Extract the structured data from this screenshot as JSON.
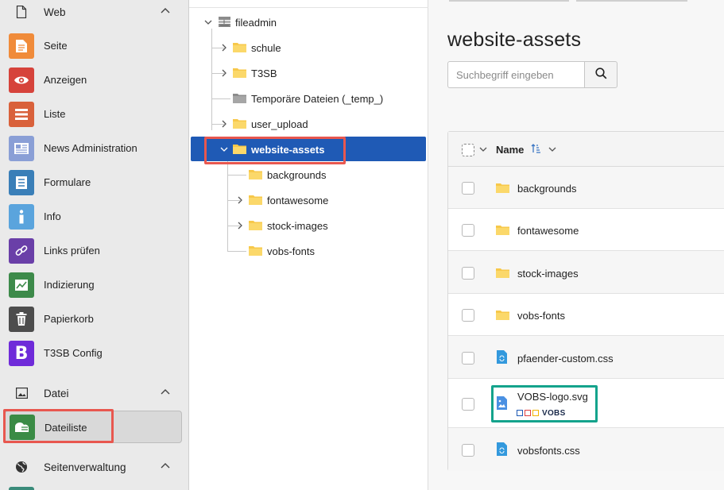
{
  "sidebar": {
    "groups": [
      {
        "label": "Web",
        "icon": "page-icon"
      },
      {
        "label": "Datei",
        "icon": "image-icon"
      },
      {
        "label": "Seitenverwaltung",
        "icon": "globe-icon"
      }
    ],
    "modules": [
      {
        "label": "Seite",
        "color": "#f08b3a"
      },
      {
        "label": "Anzeigen",
        "color": "#d6433b"
      },
      {
        "label": "Liste",
        "color": "#d9613b"
      },
      {
        "label": "News Administration",
        "color": "#8a9fd6"
      },
      {
        "label": "Formulare",
        "color": "#3a7fb8"
      },
      {
        "label": "Info",
        "color": "#5aa4dd"
      },
      {
        "label": "Links prüfen",
        "color": "#6a3fa8"
      },
      {
        "label": "Indizierung",
        "color": "#3d8a4a"
      },
      {
        "label": "Papierkorb",
        "color": "#4d4d4d"
      },
      {
        "label": "T3SB Config",
        "color": "#6f2bd9",
        "glyph": "B"
      },
      {
        "label": "Dateiliste",
        "color": "#3a8b45"
      }
    ]
  },
  "tree": {
    "root": "fileadmin",
    "nodes": [
      {
        "label": "schule"
      },
      {
        "label": "T3SB"
      },
      {
        "label": "Temporäre Dateien (_temp_)"
      },
      {
        "label": "user_upload"
      },
      {
        "label": "website-assets"
      },
      {
        "label": "backgrounds"
      },
      {
        "label": "fontawesome"
      },
      {
        "label": "stock-images"
      },
      {
        "label": "vobs-fonts"
      }
    ]
  },
  "main": {
    "title": "website-assets",
    "search_placeholder": "Suchbegriff eingeben",
    "column_name": "Name",
    "rows": [
      {
        "name": "backgrounds",
        "type": "folder"
      },
      {
        "name": "fontawesome",
        "type": "folder"
      },
      {
        "name": "stock-images",
        "type": "folder"
      },
      {
        "name": "vobs-fonts",
        "type": "folder"
      },
      {
        "name": "pfaender-custom.css",
        "type": "css"
      },
      {
        "name": "VOBS-logo.svg",
        "type": "svg",
        "thumb_text": "VOBS"
      },
      {
        "name": "vobsfonts.css",
        "type": "css"
      }
    ]
  },
  "colors": {
    "folder": "#f7c84a",
    "selection": "#1f5ab5",
    "highlight_red": "#e8574f",
    "highlight_teal": "#14a38c"
  }
}
